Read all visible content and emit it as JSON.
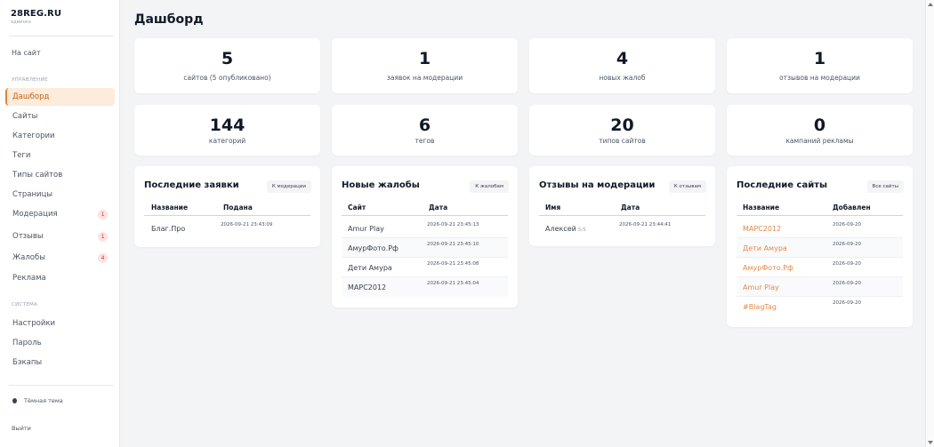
{
  "brand": {
    "title": "28REG.RU",
    "subtitle": "админка"
  },
  "sidebar": {
    "site_link": "На сайт",
    "section_manage": "УПРАВЛЕНИЕ",
    "manage_items": [
      {
        "label": "Дашборд",
        "active": true
      },
      {
        "label": "Сайты"
      },
      {
        "label": "Категории"
      },
      {
        "label": "Теги"
      },
      {
        "label": "Типы сайтов"
      },
      {
        "label": "Страницы"
      },
      {
        "label": "Модерация",
        "badge": "1"
      },
      {
        "label": "Отзывы",
        "badge": "1"
      },
      {
        "label": "Жалобы",
        "badge": "4"
      },
      {
        "label": "Реклама"
      }
    ],
    "section_system": "СИСТЕМА",
    "system_items": [
      {
        "label": "Настройки"
      },
      {
        "label": "Пароль"
      },
      {
        "label": "Бэкапы"
      }
    ],
    "theme_toggle": "Тёмная тема",
    "logout": "Выйти"
  },
  "page_title": "Дашборд",
  "stats": [
    {
      "value": "5",
      "label": "сайтов (5 опубликовано)"
    },
    {
      "value": "1",
      "label": "заявок на модерации"
    },
    {
      "value": "4",
      "label": "новых жалоб"
    },
    {
      "value": "1",
      "label": "отзывов на модерации"
    },
    {
      "value": "144",
      "label": "категорий"
    },
    {
      "value": "6",
      "label": "тегов"
    },
    {
      "value": "20",
      "label": "типов сайтов"
    },
    {
      "value": "0",
      "label": "кампаний рекламы"
    }
  ],
  "panels": {
    "requests": {
      "title": "Последние заявки",
      "button": "К модерации",
      "columns": [
        "Название",
        "Подана"
      ],
      "rows": [
        {
          "name": "Благ.Про",
          "date": "2026-09-21 23:43:09"
        }
      ]
    },
    "complaints": {
      "title": "Новые жалобы",
      "button": "К жалобам",
      "columns": [
        "Сайт",
        "Дата"
      ],
      "rows": [
        {
          "name": "Amur Play",
          "date": "2026-09-21 23:45:13"
        },
        {
          "name": "АмурФото.Рф",
          "date": "2026-09-21 23:45:10"
        },
        {
          "name": "Дети Амура",
          "date": "2026-09-21 23:45:08"
        },
        {
          "name": "МАРС2012",
          "date": "2026-09-21 23:45:04"
        }
      ]
    },
    "reviews": {
      "title": "Отзывы на модерации",
      "button": "К отзывам",
      "columns": [
        "Имя",
        "Дата"
      ],
      "rows": [
        {
          "name": "Алексей",
          "rating": "5/5",
          "date": "2026-09-21 23:44:41"
        }
      ]
    },
    "sites": {
      "title": "Последние сайты",
      "button": "Все сайты",
      "columns": [
        "Название",
        "Добавлен"
      ],
      "rows": [
        {
          "name": "МАРС2012",
          "date": "2026-09-20"
        },
        {
          "name": "Дети Амура",
          "date": "2026-09-20"
        },
        {
          "name": "АмурФото.Рф",
          "date": "2026-09-20"
        },
        {
          "name": "Amur Play",
          "date": "2026-09-20"
        },
        {
          "name": "#BlagTag",
          "date": "2026-09-20"
        }
      ]
    }
  },
  "colors": {
    "accent": "#e08a4a",
    "active_bg": "#fdebdc",
    "badge_bg": "#fde2e2",
    "badge_text": "#dc2626"
  }
}
